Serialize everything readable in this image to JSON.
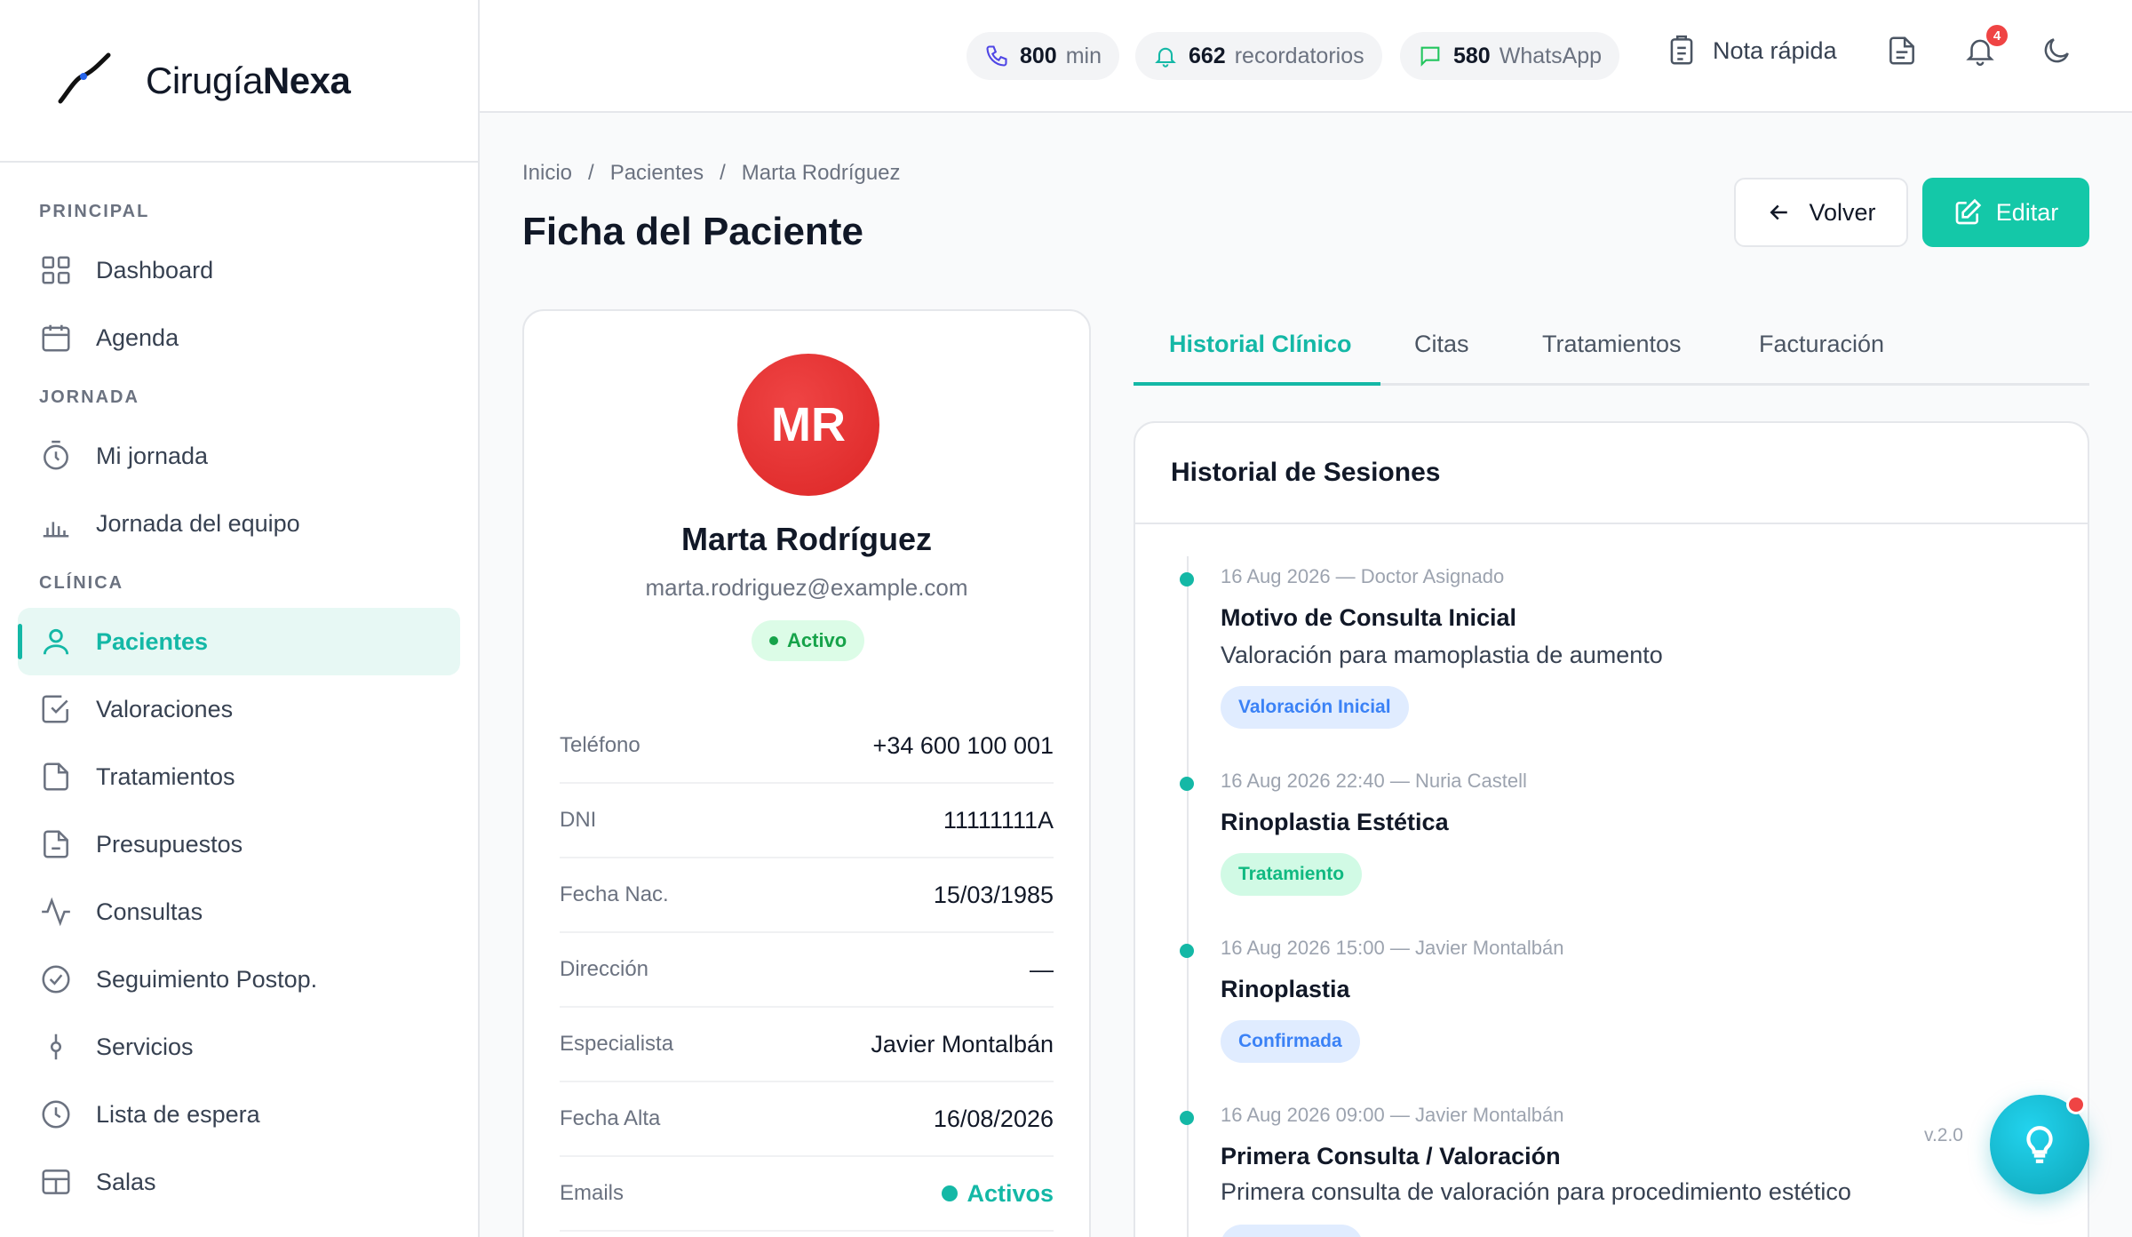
{
  "brand": {
    "name_light": "Cirugía",
    "name_bold": "Nexa"
  },
  "sidebar": {
    "sections": [
      {
        "title": "PRINCIPAL",
        "items": [
          {
            "label": "Dashboard",
            "icon": "grid-icon"
          },
          {
            "label": "Agenda",
            "icon": "calendar-icon"
          }
        ]
      },
      {
        "title": "JORNADA",
        "items": [
          {
            "label": "Mi jornada",
            "icon": "stopwatch-icon"
          },
          {
            "label": "Jornada del equipo",
            "icon": "bar-chart-icon"
          }
        ]
      },
      {
        "title": "CLÍNICA",
        "items": [
          {
            "label": "Pacientes",
            "icon": "user-icon",
            "active": true
          },
          {
            "label": "Valoraciones",
            "icon": "check-square-icon"
          },
          {
            "label": "Tratamientos",
            "icon": "file-icon"
          },
          {
            "label": "Presupuestos",
            "icon": "file-text-icon"
          },
          {
            "label": "Consultas",
            "icon": "activity-icon"
          },
          {
            "label": "Seguimiento Postop.",
            "icon": "check-circle-icon"
          },
          {
            "label": "Servicios",
            "icon": "git-commit-icon"
          },
          {
            "label": "Lista de espera",
            "icon": "clock-icon"
          },
          {
            "label": "Salas",
            "icon": "layout-icon"
          }
        ]
      }
    ]
  },
  "header": {
    "counters": [
      {
        "num": "800",
        "unit": "min",
        "icon": "phone-icon"
      },
      {
        "num": "662",
        "unit": "recordatorios",
        "icon": "bell-icon"
      },
      {
        "num": "580",
        "unit": "WhatsApp",
        "icon": "message-icon"
      }
    ],
    "quick_note_label": "Nota rápida",
    "notifications_count": "4"
  },
  "breadcrumb": [
    "Inicio",
    "Pacientes",
    "Marta Rodríguez"
  ],
  "page_title": "Ficha del Paciente",
  "actions": {
    "back": "Volver",
    "edit": "Editar"
  },
  "patient": {
    "initials": "MR",
    "name": "Marta Rodríguez",
    "email": "marta.rodriguez@example.com",
    "status": "Activo",
    "fields": [
      {
        "key": "Teléfono",
        "value": "+34 600 100 001"
      },
      {
        "key": "DNI",
        "value": "11111111A"
      },
      {
        "key": "Fecha Nac.",
        "value": "15/03/1985"
      },
      {
        "key": "Dirección",
        "value": "—"
      },
      {
        "key": "Especialista",
        "value": "Javier Montalbán"
      },
      {
        "key": "Fecha Alta",
        "value": "16/08/2026"
      },
      {
        "key": "Emails",
        "value": "Activos"
      }
    ]
  },
  "tabs": [
    "Historial Clínico",
    "Citas",
    "Tratamientos",
    "Facturación"
  ],
  "history": {
    "title": "Historial de Sesiones",
    "entries": [
      {
        "meta": "16 Aug 2026 — Doctor Asignado",
        "title": "Motivo de Consulta Inicial",
        "desc": "Valoración para mamoplastia de aumento",
        "tag": "Valoración Inicial",
        "tag_color": "#3b82f6"
      },
      {
        "meta": "16 Aug 2026 22:40 — Nuria Castell",
        "title": "Rinoplastia Estética",
        "desc": "",
        "tag": "Tratamiento",
        "tag_color": "#10b981"
      },
      {
        "meta": "16 Aug 2026 15:00 — Javier Montalbán",
        "title": "Rinoplastia",
        "desc": "",
        "tag": "Confirmada",
        "tag_color": "#3b82f6"
      },
      {
        "meta": "16 Aug 2026 09:00 — Javier Montalbán",
        "title": "Primera Consulta / Valoración",
        "desc": "Primera consulta de valoración para procedimiento estético",
        "tag": "",
        "tag_color": "#3b82f6"
      }
    ]
  },
  "version": "v.2.0",
  "colors": {
    "accent": "#14b8a6",
    "danger": "#ef4444"
  }
}
